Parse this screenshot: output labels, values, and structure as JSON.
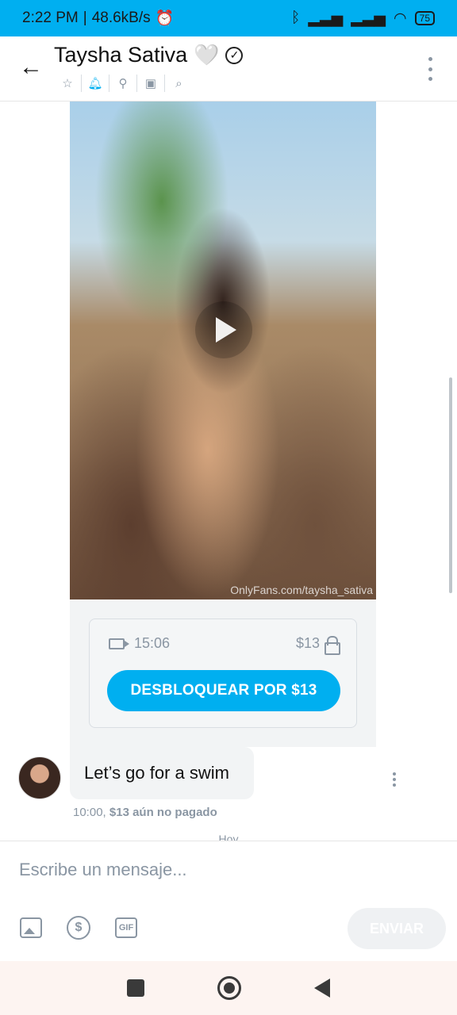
{
  "status_bar": {
    "time": "2:22 PM",
    "speed": "48.6kB/s",
    "battery": "75"
  },
  "header": {
    "title": "Taysha Sativa",
    "heart": "🤍",
    "actions": [
      "star-icon",
      "bell-icon",
      "pin-icon",
      "media-icon",
      "search-icon"
    ]
  },
  "video": {
    "watermark": "OnlyFans.com/taysha_sativa"
  },
  "locked_media": {
    "duration": "15:06",
    "price": "$13",
    "unlock_label": "DESBLOQUEAR POR $13"
  },
  "message": {
    "text": "Let’s go for a swim",
    "time": "10:00,",
    "status": "$13 aún no pagado"
  },
  "day_separator": "Hoy",
  "composer": {
    "placeholder": "Escribe un mensaje...",
    "send_label": "ENVIAR",
    "gif_label": "GIF"
  },
  "colors": {
    "accent": "#00aff0",
    "muted": "#8a96a3"
  }
}
